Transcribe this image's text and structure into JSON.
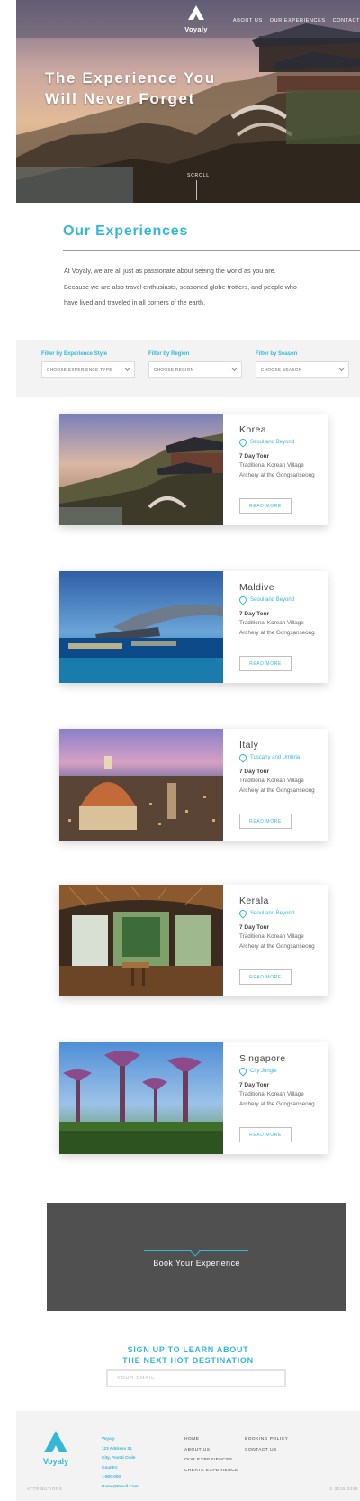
{
  "brand": {
    "name": "Voyaly",
    "accent": "#35b8d6",
    "dark_panel": "#505050"
  },
  "nav": {
    "links": [
      "ABOUT US",
      "OUR EXPERIENCES",
      "CONTACT"
    ]
  },
  "hero": {
    "title_line1": "The Experience You",
    "title_line2": "Will Never Forget",
    "scroll_label": "SCROLL"
  },
  "intro": {
    "title": "Our Experiences",
    "paragraph": "At Voyaly, we are all just as passionate about seeing the world as you are. Because we are also travel enthusiasts, seasoned globe-trotters, and people who have lived and traveled in all corners of the earth."
  },
  "filters": [
    {
      "label": "Filter by Experience Style",
      "selected": "CHOOSE EXPERIENCE TYPE"
    },
    {
      "label": "Filter by Region",
      "selected": "CHOOSE REGION"
    },
    {
      "label": "Filter by Season",
      "selected": "CHOOSE SEASON"
    }
  ],
  "experiences": [
    {
      "title": "Korea",
      "location": "Seoul and Beyond",
      "tour": "7 Day Tour",
      "description": "Traditional Korean Village Archery at the Gongsanseong",
      "button": "READ MORE",
      "image_icon": "korea-temple-image"
    },
    {
      "title": "Maldive",
      "location": "Seoul and Beyond",
      "tour": "7 Day Tour",
      "description": "Traditional Korean Village Archery at the Gongsanseong",
      "button": "READ MORE",
      "image_icon": "maldives-resort-image"
    },
    {
      "title": "Italy",
      "location": "Tuscany and Umbria",
      "tour": "7 Day Tour",
      "description": "Traditional Korean Village Archery at the Gongsanseong",
      "button": "READ MORE",
      "image_icon": "florence-dome-image"
    },
    {
      "title": "Kerala",
      "location": "Seoul and Beyond",
      "tour": "7 Day Tour",
      "description": "Traditional Korean Village Archery at the Gongsanseong",
      "button": "READ MORE",
      "image_icon": "kerala-houseboat-image"
    },
    {
      "title": "Singapore",
      "location": "City Jungle",
      "tour": "7 Day Tour",
      "description": "Traditional Korean Village Archery at the Gongsanseong",
      "button": "READ MORE",
      "image_icon": "singapore-supertrees-image"
    }
  ],
  "booking": {
    "label": "Book Your Experience"
  },
  "signup": {
    "line1": "SIGN UP TO LEARN ABOUT",
    "line2": "THE NEXT HOT DESTINATION",
    "placeholder": "YOUR EMAIL"
  },
  "footer": {
    "address": [
      "Voyaly",
      "123 Address St.",
      "City, Postal Code",
      "Country",
      "1-800-000",
      "Name@Email.Com"
    ],
    "col1": [
      "HOME",
      "ABOUT US",
      "OUR EXPERIENCES",
      "CREATE EXPERIENCE"
    ],
    "col2": [
      "BOOKING POLICY",
      "CONTACT US"
    ],
    "attributions": "ATTRIBUTIONS",
    "copyright": "© 2015 2016"
  }
}
